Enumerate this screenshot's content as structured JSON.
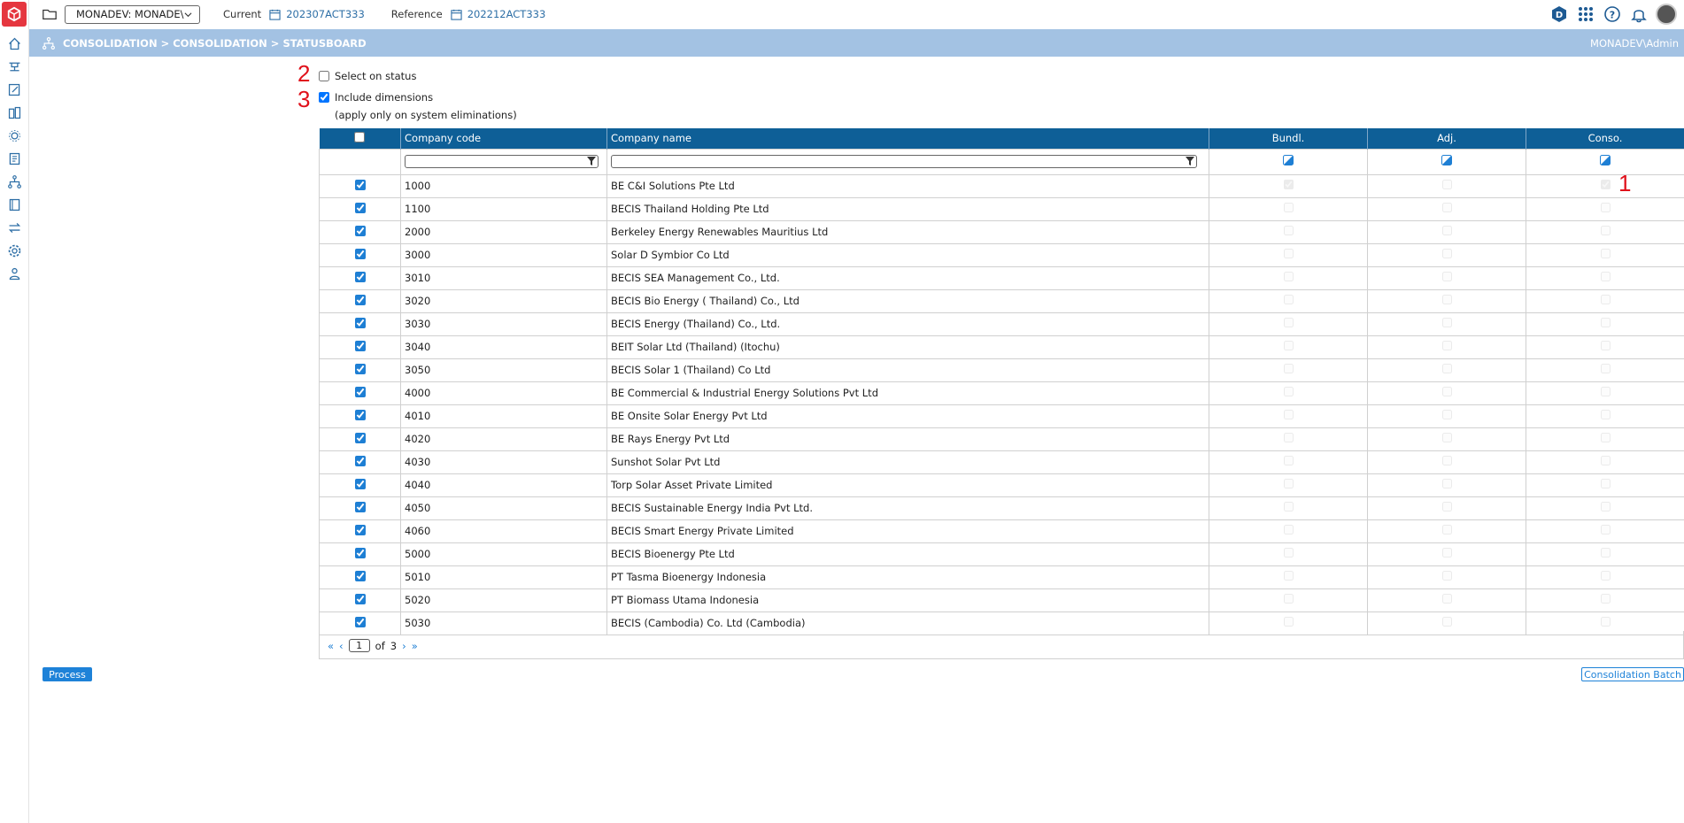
{
  "topbar": {
    "environment": "MONADEV: MONADE\\",
    "current_label": "Current",
    "current_value": "202307ACT333",
    "reference_label": "Reference",
    "reference_value": "202212ACT333"
  },
  "breadcrumb": {
    "path": "CONSOLIDATION > CONSOLIDATION > STATUSBOARD",
    "user": "MONADEV\\Admin"
  },
  "options": {
    "select_on_status": {
      "label": "Select on status",
      "checked": false,
      "marker": "2"
    },
    "include_dimensions": {
      "label": "Include dimensions",
      "checked": true,
      "marker": "3"
    },
    "note": "(apply only on system eliminations)"
  },
  "table": {
    "headers": {
      "code": "Company code",
      "name": "Company name",
      "bundl": "Bundl.",
      "adj": "Adj.",
      "conso": "Conso."
    },
    "marker_1": "1",
    "rows": [
      {
        "code": "1000",
        "name": "BE C&I Solutions Pte Ltd",
        "bundl": true,
        "adj": false,
        "conso": true
      },
      {
        "code": "1100",
        "name": "BECIS Thailand Holding Pte Ltd",
        "bundl": false,
        "adj": false,
        "conso": false
      },
      {
        "code": "2000",
        "name": "Berkeley Energy Renewables Mauritius Ltd",
        "bundl": false,
        "adj": false,
        "conso": false
      },
      {
        "code": "3000",
        "name": "Solar D Symbior Co Ltd",
        "bundl": false,
        "adj": false,
        "conso": false
      },
      {
        "code": "3010",
        "name": "BECIS SEA Management Co., Ltd.",
        "bundl": false,
        "adj": false,
        "conso": false
      },
      {
        "code": "3020",
        "name": "BECIS Bio Energy ( Thailand) Co., Ltd",
        "bundl": false,
        "adj": false,
        "conso": false
      },
      {
        "code": "3030",
        "name": "BECIS Energy (Thailand) Co., Ltd.",
        "bundl": false,
        "adj": false,
        "conso": false
      },
      {
        "code": "3040",
        "name": "BEIT Solar Ltd (Thailand) (Itochu)",
        "bundl": false,
        "adj": false,
        "conso": false
      },
      {
        "code": "3050",
        "name": "BECIS Solar 1 (Thailand) Co Ltd",
        "bundl": false,
        "adj": false,
        "conso": false
      },
      {
        "code": "4000",
        "name": "BE Commercial & Industrial Energy Solutions Pvt Ltd",
        "bundl": false,
        "adj": false,
        "conso": false
      },
      {
        "code": "4010",
        "name": "BE Onsite Solar Energy Pvt Ltd",
        "bundl": false,
        "adj": false,
        "conso": false
      },
      {
        "code": "4020",
        "name": "BE Rays Energy Pvt Ltd",
        "bundl": false,
        "adj": false,
        "conso": false
      },
      {
        "code": "4030",
        "name": "Sunshot Solar Pvt Ltd",
        "bundl": false,
        "adj": false,
        "conso": false
      },
      {
        "code": "4040",
        "name": "Torp Solar Asset Private Limited",
        "bundl": false,
        "adj": false,
        "conso": false
      },
      {
        "code": "4050",
        "name": "BECIS Sustainable Energy India Pvt Ltd.",
        "bundl": false,
        "adj": false,
        "conso": false
      },
      {
        "code": "4060",
        "name": "BECIS Smart Energy Private Limited",
        "bundl": false,
        "adj": false,
        "conso": false
      },
      {
        "code": "5000",
        "name": "BECIS Bioenergy Pte Ltd",
        "bundl": false,
        "adj": false,
        "conso": false
      },
      {
        "code": "5010",
        "name": "PT Tasma Bioenergy Indonesia",
        "bundl": false,
        "adj": false,
        "conso": false
      },
      {
        "code": "5020",
        "name": "PT Biomass Utama Indonesia",
        "bundl": false,
        "adj": false,
        "conso": false
      },
      {
        "code": "5030",
        "name": "BECIS (Cambodia) Co. Ltd (Cambodia)",
        "bundl": false,
        "adj": false,
        "conso": false
      }
    ]
  },
  "pager": {
    "current_page": "1",
    "of_label": "of",
    "total_pages": "3"
  },
  "buttons": {
    "process": "Process",
    "consolidation_batch": "Consolidation Batch"
  },
  "colors": {
    "header_blue": "#0e5f97",
    "crumb_blue": "#a3c2e3",
    "accent_blue": "#1e82d8",
    "brand_red": "#e5363f",
    "marker_red": "#e0111b"
  }
}
